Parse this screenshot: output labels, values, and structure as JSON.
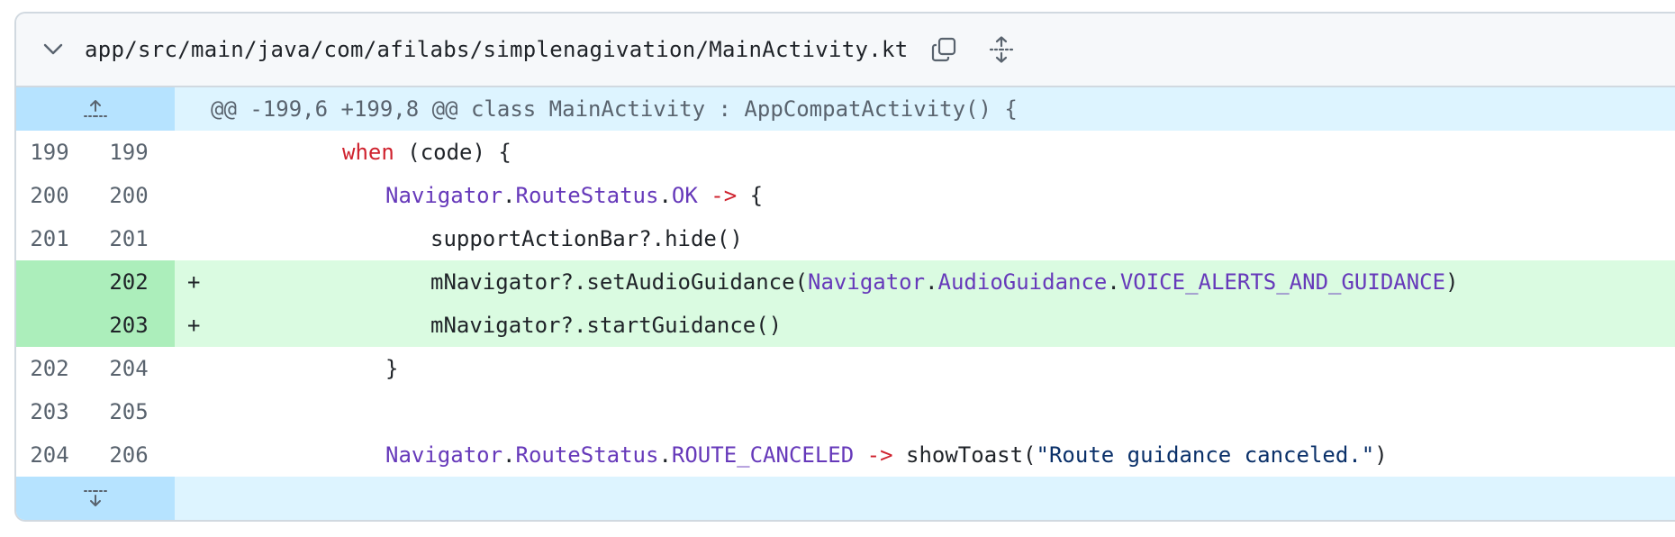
{
  "file": {
    "path": "app/src/main/java/com/afilabs/simplenagivation/MainActivity.kt",
    "icons": {
      "collapse": "chevron-down-icon",
      "copy": "copy-icon",
      "expand_all": "unfold-icon"
    }
  },
  "hunk_top": {
    "header": "@@ -199,6 +199,8 @@ class MainActivity : AppCompatActivity() {",
    "icon": "expand-up-icon"
  },
  "hunk_bottom": {
    "icon": "expand-down-icon"
  },
  "lines": [
    {
      "old": "199",
      "new": "199",
      "marker": "",
      "type": "context",
      "tokens": [
        {
          "t": "when",
          "c": "kw"
        },
        {
          "t": " (code) {",
          "c": "pl"
        }
      ]
    },
    {
      "old": "200",
      "new": "200",
      "marker": "",
      "type": "context",
      "tokens": [
        {
          "t": "Navigator",
          "c": "ty"
        },
        {
          "t": ".",
          "c": "pl"
        },
        {
          "t": "RouteStatus",
          "c": "ty"
        },
        {
          "t": ".",
          "c": "pl"
        },
        {
          "t": "OK",
          "c": "ct"
        },
        {
          "t": " ",
          "c": "pl"
        },
        {
          "t": "->",
          "c": "kw"
        },
        {
          "t": " {",
          "c": "pl"
        }
      ]
    },
    {
      "old": "201",
      "new": "201",
      "marker": "",
      "type": "context",
      "tokens": [
        {
          "t": "supportActionBar?.hide()",
          "c": "pl"
        }
      ]
    },
    {
      "old": "",
      "new": "202",
      "marker": "+",
      "type": "add",
      "tokens": [
        {
          "t": "mNavigator?.setAudioGuidance(",
          "c": "pl"
        },
        {
          "t": "Navigator",
          "c": "ty"
        },
        {
          "t": ".",
          "c": "pl"
        },
        {
          "t": "AudioGuidance",
          "c": "ty"
        },
        {
          "t": ".",
          "c": "pl"
        },
        {
          "t": "VOICE_ALERTS_AND_GUIDANCE",
          "c": "ct"
        },
        {
          "t": ")",
          "c": "pl"
        }
      ]
    },
    {
      "old": "",
      "new": "203",
      "marker": "+",
      "type": "add",
      "tokens": [
        {
          "t": "mNavigator?.startGuidance()",
          "c": "pl"
        }
      ]
    },
    {
      "old": "202",
      "new": "204",
      "marker": "",
      "type": "context",
      "tokens": [
        {
          "t": "}",
          "c": "pl"
        }
      ]
    },
    {
      "old": "203",
      "new": "205",
      "marker": "",
      "type": "context",
      "tokens": []
    },
    {
      "old": "204",
      "new": "206",
      "marker": "",
      "type": "context",
      "tokens": [
        {
          "t": "Navigator",
          "c": "ty"
        },
        {
          "t": ".",
          "c": "pl"
        },
        {
          "t": "RouteStatus",
          "c": "ty"
        },
        {
          "t": ".",
          "c": "pl"
        },
        {
          "t": "ROUTE_CANCELED",
          "c": "ct"
        },
        {
          "t": " ",
          "c": "pl"
        },
        {
          "t": "->",
          "c": "kw"
        },
        {
          "t": " showToast(",
          "c": "pl"
        },
        {
          "t": "\"Route guidance canceled.\"",
          "c": "st"
        },
        {
          "t": ")",
          "c": "pl"
        }
      ]
    }
  ],
  "colors": {
    "keyword": "#cf222e",
    "type": "#6639ba",
    "string": "#0a3069",
    "add_bg": "#dafbe1",
    "add_gutter": "#aceebb",
    "hunk_bg": "#ddf4ff",
    "hunk_gutter": "#b6e3ff"
  }
}
